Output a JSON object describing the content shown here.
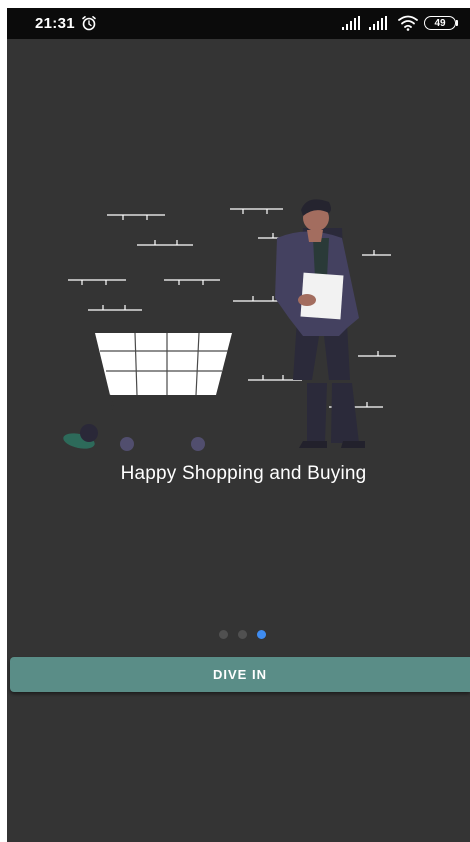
{
  "status_bar": {
    "time": "21:31",
    "battery_level": "49",
    "icons": [
      "alarm-icon",
      "signal-icon",
      "signal-icon",
      "wifi-icon",
      "battery-icon"
    ]
  },
  "illustration": {
    "name": "shopping-cart-person-illustration"
  },
  "onboarding": {
    "headline": "Happy Shopping and Buying",
    "page_count": 3,
    "active_page_index": 2
  },
  "cta": {
    "label": "DIVE IN"
  },
  "colors": {
    "background": "#343434",
    "status_bar": "#0b0b0b",
    "button": "#5a8d87",
    "active_dot": "#3f8cf0",
    "inactive_dot": "#505050"
  }
}
